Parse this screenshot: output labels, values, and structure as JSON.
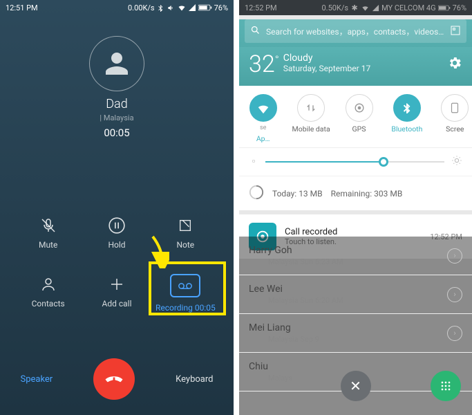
{
  "left": {
    "status": {
      "time": "12:51 PM",
      "net": "0.00K/s",
      "battery": "76%"
    },
    "call": {
      "name": "Dad",
      "location": "Malaysia",
      "duration": "00:05"
    },
    "buttons": {
      "mute": "Mute",
      "hold": "Hold",
      "note": "Note",
      "contacts": "Contacts",
      "addcall": "Add call",
      "recording": "Recording 00:05"
    },
    "bottom": {
      "speaker": "Speaker",
      "keyboard": "Keyboard"
    }
  },
  "right": {
    "status": {
      "time": "12:52 PM",
      "net": "0.50K/s",
      "carrier": "MY CELCOM 4G",
      "battery": "76%"
    },
    "search": {
      "placeholder": "Search for websites，apps，contacts，videos…"
    },
    "weather": {
      "temp": "32",
      "unit": "°",
      "cond": "Cloudy",
      "date": "Saturday, September 17"
    },
    "toggles": {
      "wifi": "Ap…",
      "data": "Mobile data",
      "gps": "GPS",
      "bt": "Bluetooth",
      "screen": "Scree"
    },
    "data_usage": {
      "today": "Today: 13 MB",
      "remain": "Remaining: 303 MB"
    },
    "notification": {
      "title": "Call recorded",
      "sub": "Touch to listen.",
      "time": "12:52 PM"
    },
    "contacts": [
      {
        "name": "Harry Goh",
        "meta": "Malaysia Sun 6:23 AM"
      },
      {
        "name": "Lee Wei",
        "meta": "Malaysia Sun 6:20 AM"
      },
      {
        "name": "Mei Liang",
        "meta": "Malaysia Sep 9"
      },
      {
        "name": "Chiu",
        "meta": "Malays"
      }
    ]
  }
}
